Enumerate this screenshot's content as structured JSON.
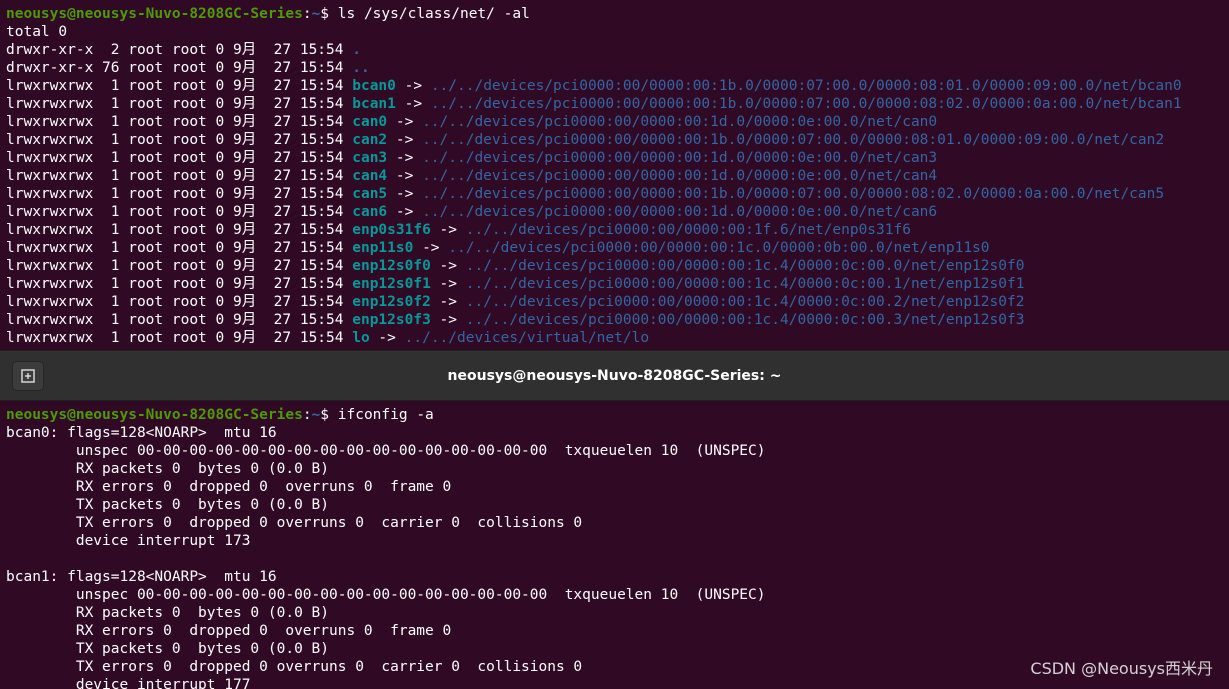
{
  "top_terminal": {
    "prompt_user": "neousys@neousys-Nuvo-8208GC-Series",
    "prompt_path": "~",
    "command": "ls /sys/class/net/ -al",
    "total": "total 0",
    "rows": [
      {
        "meta": "drwxr-xr-x  2 root root 0 9月  27 15:54 ",
        "name": ".",
        "kind": "dir",
        "target": ""
      },
      {
        "meta": "drwxr-xr-x 76 root root 0 9月  27 15:54 ",
        "name": "..",
        "kind": "dir",
        "target": ""
      },
      {
        "meta": "lrwxrwxrwx  1 root root 0 9月  27 15:54 ",
        "name": "bcan0",
        "kind": "link",
        "target": "../../devices/pci0000:00/0000:00:1b.0/0000:07:00.0/0000:08:01.0/0000:09:00.0/net/bcan0"
      },
      {
        "meta": "lrwxrwxrwx  1 root root 0 9月  27 15:54 ",
        "name": "bcan1",
        "kind": "link",
        "target": "../../devices/pci0000:00/0000:00:1b.0/0000:07:00.0/0000:08:02.0/0000:0a:00.0/net/bcan1"
      },
      {
        "meta": "lrwxrwxrwx  1 root root 0 9月  27 15:54 ",
        "name": "can0",
        "kind": "link",
        "target": "../../devices/pci0000:00/0000:00:1d.0/0000:0e:00.0/net/can0"
      },
      {
        "meta": "lrwxrwxrwx  1 root root 0 9月  27 15:54 ",
        "name": "can2",
        "kind": "link",
        "target": "../../devices/pci0000:00/0000:00:1b.0/0000:07:00.0/0000:08:01.0/0000:09:00.0/net/can2"
      },
      {
        "meta": "lrwxrwxrwx  1 root root 0 9月  27 15:54 ",
        "name": "can3",
        "kind": "link",
        "target": "../../devices/pci0000:00/0000:00:1d.0/0000:0e:00.0/net/can3"
      },
      {
        "meta": "lrwxrwxrwx  1 root root 0 9月  27 15:54 ",
        "name": "can4",
        "kind": "link",
        "target": "../../devices/pci0000:00/0000:00:1d.0/0000:0e:00.0/net/can4"
      },
      {
        "meta": "lrwxrwxrwx  1 root root 0 9月  27 15:54 ",
        "name": "can5",
        "kind": "link",
        "target": "../../devices/pci0000:00/0000:00:1b.0/0000:07:00.0/0000:08:02.0/0000:0a:00.0/net/can5"
      },
      {
        "meta": "lrwxrwxrwx  1 root root 0 9月  27 15:54 ",
        "name": "can6",
        "kind": "link",
        "target": "../../devices/pci0000:00/0000:00:1d.0/0000:0e:00.0/net/can6"
      },
      {
        "meta": "lrwxrwxrwx  1 root root 0 9月  27 15:54 ",
        "name": "enp0s31f6",
        "kind": "link",
        "target": "../../devices/pci0000:00/0000:00:1f.6/net/enp0s31f6"
      },
      {
        "meta": "lrwxrwxrwx  1 root root 0 9月  27 15:54 ",
        "name": "enp11s0",
        "kind": "link",
        "target": "../../devices/pci0000:00/0000:00:1c.0/0000:0b:00.0/net/enp11s0"
      },
      {
        "meta": "lrwxrwxrwx  1 root root 0 9月  27 15:54 ",
        "name": "enp12s0f0",
        "kind": "link",
        "target": "../../devices/pci0000:00/0000:00:1c.4/0000:0c:00.0/net/enp12s0f0"
      },
      {
        "meta": "lrwxrwxrwx  1 root root 0 9月  27 15:54 ",
        "name": "enp12s0f1",
        "kind": "link",
        "target": "../../devices/pci0000:00/0000:00:1c.4/0000:0c:00.1/net/enp12s0f1"
      },
      {
        "meta": "lrwxrwxrwx  1 root root 0 9月  27 15:54 ",
        "name": "enp12s0f2",
        "kind": "link",
        "target": "../../devices/pci0000:00/0000:00:1c.4/0000:0c:00.2/net/enp12s0f2"
      },
      {
        "meta": "lrwxrwxrwx  1 root root 0 9月  27 15:54 ",
        "name": "enp12s0f3",
        "kind": "link",
        "target": "../../devices/pci0000:00/0000:00:1c.4/0000:0c:00.3/net/enp12s0f3"
      },
      {
        "meta": "lrwxrwxrwx  1 root root 0 9月  27 15:54 ",
        "name": "lo",
        "kind": "link",
        "target": "../../devices/virtual/net/lo"
      }
    ]
  },
  "titlebar": {
    "title": "neousys@neousys-Nuvo-8208GC-Series: ~",
    "new_tab_icon": "new-tab-icon"
  },
  "bottom_terminal": {
    "prompt_user": "neousys@neousys-Nuvo-8208GC-Series",
    "prompt_path": "~",
    "command": "ifconfig -a",
    "lines": [
      "bcan0: flags=128<NOARP>  mtu 16",
      "        unspec 00-00-00-00-00-00-00-00-00-00-00-00-00-00-00-00  txqueuelen 10  (UNSPEC)",
      "        RX packets 0  bytes 0 (0.0 B)",
      "        RX errors 0  dropped 0  overruns 0  frame 0",
      "        TX packets 0  bytes 0 (0.0 B)",
      "        TX errors 0  dropped 0 overruns 0  carrier 0  collisions 0",
      "        device interrupt 173",
      "",
      "bcan1: flags=128<NOARP>  mtu 16",
      "        unspec 00-00-00-00-00-00-00-00-00-00-00-00-00-00-00-00  txqueuelen 10  (UNSPEC)",
      "        RX packets 0  bytes 0 (0.0 B)",
      "        RX errors 0  dropped 0  overruns 0  frame 0",
      "        TX packets 0  bytes 0 (0.0 B)",
      "        TX errors 0  dropped 0 overruns 0  carrier 0  collisions 0",
      "        device interrupt 177"
    ]
  },
  "watermark": "CSDN @Neousys西米丹",
  "colors": {
    "background": "#300a24",
    "prompt_user": "#4e9a06",
    "prompt_path": "#3465a4",
    "link_name": "#06989a",
    "titlebar": "#303030"
  }
}
